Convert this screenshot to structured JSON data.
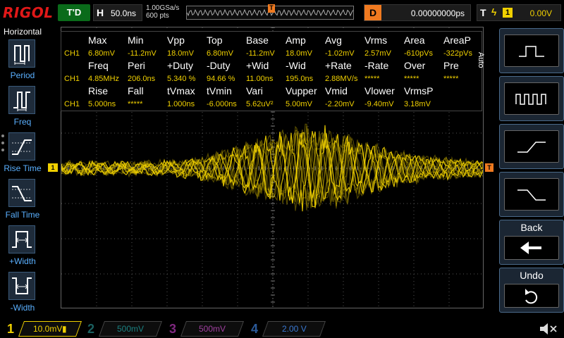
{
  "brand": {
    "logo_text": "RIGOL"
  },
  "status": {
    "run_state": "T'D"
  },
  "horizontal": {
    "letter": "H",
    "timebase": "50.0ns",
    "sample_rate": "1.00GSa/s",
    "memory_depth": "600 pts",
    "trigger_marker": "T"
  },
  "delay": {
    "letter": "D",
    "value": "0.00000000ps"
  },
  "trigger": {
    "letter": "T",
    "edge_symbol": "ϟ",
    "source": "1",
    "level": "0.00V"
  },
  "left_menu": {
    "title": "Horizontal",
    "items": [
      {
        "label": "Period",
        "icon": "period-icon"
      },
      {
        "label": "Freq",
        "icon": "freq-icon"
      },
      {
        "label": "Rise Time",
        "icon": "rise-time-icon"
      },
      {
        "label": "Fall Time",
        "icon": "fall-time-icon"
      },
      {
        "label": "+Width",
        "icon": "positive-width-icon"
      },
      {
        "label": "-Width",
        "icon": "negative-width-icon"
      }
    ]
  },
  "measurements": {
    "channel_label": "CH1",
    "rows": [
      {
        "headers": [
          "Max",
          "Min",
          "Vpp",
          "Top",
          "Base",
          "Amp",
          "Avg",
          "Vrms",
          "Area",
          "AreaP"
        ],
        "values": [
          "6.80mV",
          "-11.2mV",
          "18.0mV",
          "6.80mV",
          "-11.2mV",
          "18.0mV",
          "-1.02mV",
          "2.57mV",
          "-610pVs",
          "-322pVs"
        ]
      },
      {
        "headers": [
          "Freq",
          "Peri",
          "+Duty",
          "-Duty",
          "+Wid",
          "-Wid",
          "+Rate",
          "-Rate",
          "Over",
          "Pre"
        ],
        "values": [
          "4.85MHz",
          "206.0ns",
          "5.340 %",
          "94.66 %",
          "11.00ns",
          "195.0ns",
          "2.88MV/s",
          "*****",
          "*****",
          "*****"
        ]
      },
      {
        "headers": [
          "Rise",
          "Fall",
          "tVmax",
          "tVmin",
          "Vari",
          "Vupper",
          "Vmid",
          "Vlower",
          "VrmsP"
        ],
        "values": [
          "5.000ns",
          "*****",
          "1.000ns",
          "-6.000ns",
          "5.62uV²",
          "5.00mV",
          "-2.20mV",
          "-9.40mV",
          "3.18mV"
        ]
      }
    ]
  },
  "markers": {
    "ch1": "1",
    "trigger_level": "T"
  },
  "right_menu": {
    "mode_label": "Auto",
    "keys": [
      {
        "icon": "single-pulse-waveform-icon"
      },
      {
        "icon": "pulse-train-waveform-icon"
      },
      {
        "icon": "rising-edge-waveform-icon"
      },
      {
        "icon": "falling-edge-waveform-icon"
      },
      {
        "label": "Back",
        "icon": "back-arrow-icon"
      },
      {
        "label": "Undo",
        "icon": "undo-icon"
      }
    ]
  },
  "channels": [
    {
      "num": "1",
      "scale": "10.0mV",
      "color": "#f0d000",
      "active": true
    },
    {
      "num": "2",
      "scale": "500mV",
      "color": "#1aa0a0",
      "active": false
    },
    {
      "num": "3",
      "scale": "500mV",
      "color": "#c040c0",
      "active": false
    },
    {
      "num": "4",
      "scale": "2.00 V",
      "color": "#3a78d0",
      "active": false
    }
  ],
  "colors": {
    "ch1": "#f0d000",
    "trigger": "#f07a20",
    "menu_blue": "#5ab0ff",
    "background": "#000000"
  },
  "icons": {
    "sound": "speaker-muted-icon"
  }
}
